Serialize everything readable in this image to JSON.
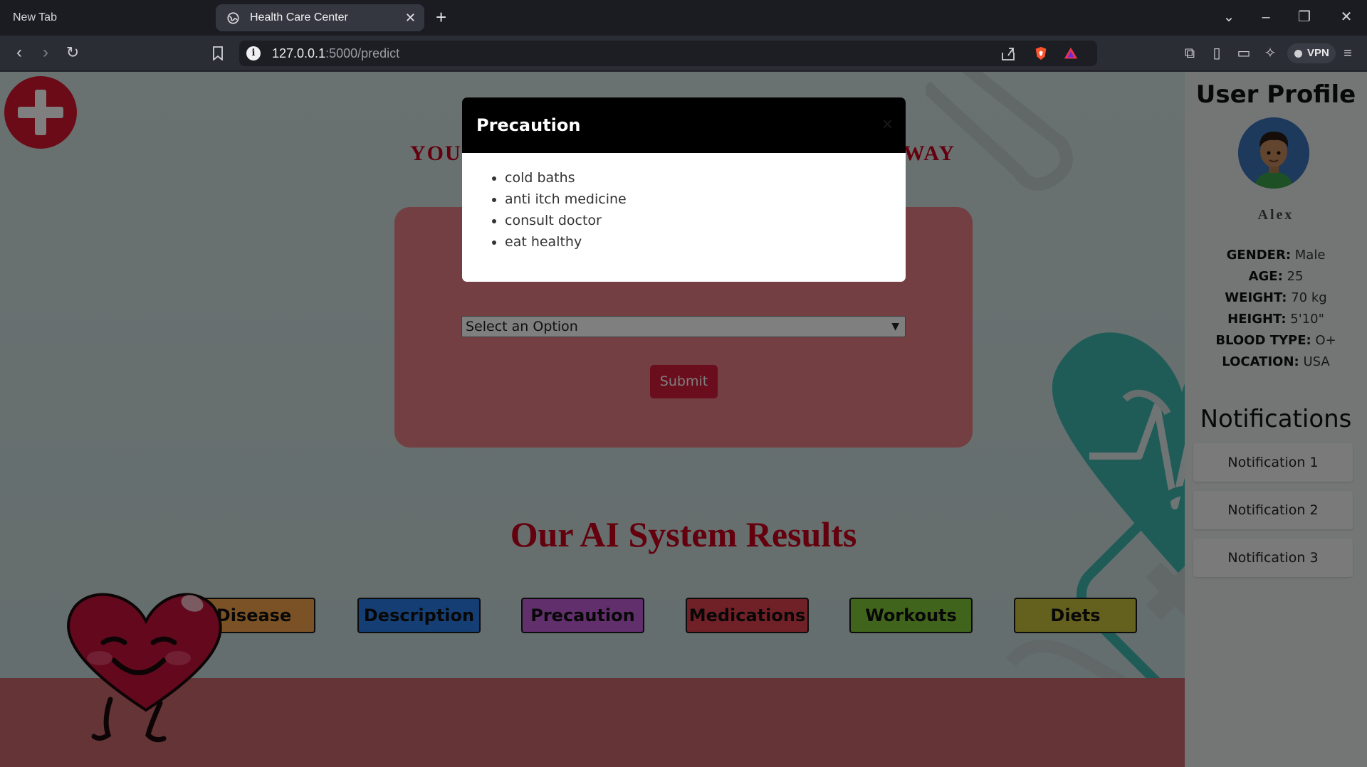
{
  "browser": {
    "tabs": [
      {
        "label": "New Tab"
      },
      {
        "label": "Health Care Center"
      }
    ],
    "url_host": "127.0.0.1",
    "url_rest": ":5000/predict",
    "vpn_label": "VPN"
  },
  "page": {
    "tagline_left": "YOU",
    "tagline_right": "WAY",
    "select_placeholder": "Select an Option",
    "submit_label": "Submit",
    "results_title": "Our AI System Results",
    "result_buttons": [
      {
        "label": "Disease",
        "color": "#f5a44a"
      },
      {
        "label": "Description",
        "color": "#2a7fe8"
      },
      {
        "label": "Precaution",
        "color": "#c35fd8"
      },
      {
        "label": "Medications",
        "color": "#e0434f"
      },
      {
        "label": "Workouts",
        "color": "#83c83a"
      },
      {
        "label": "Diets",
        "color": "#c9c03c"
      }
    ]
  },
  "sidebar": {
    "title": "User Profile",
    "name": "Alex",
    "info": [
      {
        "key": "GENDER:",
        "value": "Male"
      },
      {
        "key": "AGE:",
        "value": "25"
      },
      {
        "key": "WEIGHT:",
        "value": "70 kg"
      },
      {
        "key": "HEIGHT:",
        "value": "5'10\""
      },
      {
        "key": "BLOOD TYPE:",
        "value": "O+"
      },
      {
        "key": "LOCATION:",
        "value": "USA"
      }
    ],
    "notifications_title": "Notifications",
    "notifications": [
      "Notification 1",
      "Notification 2",
      "Notification 3"
    ]
  },
  "modal": {
    "title": "Precaution",
    "close_icon": "×",
    "items": [
      "cold baths",
      "anti itch medicine",
      "consult doctor",
      "eat healthy"
    ]
  },
  "colors": {
    "accent_red": "#c8001a",
    "logo_red": "#d7162f",
    "card_pink": "#e97f85",
    "teal_deco": "#3fb8b0"
  }
}
